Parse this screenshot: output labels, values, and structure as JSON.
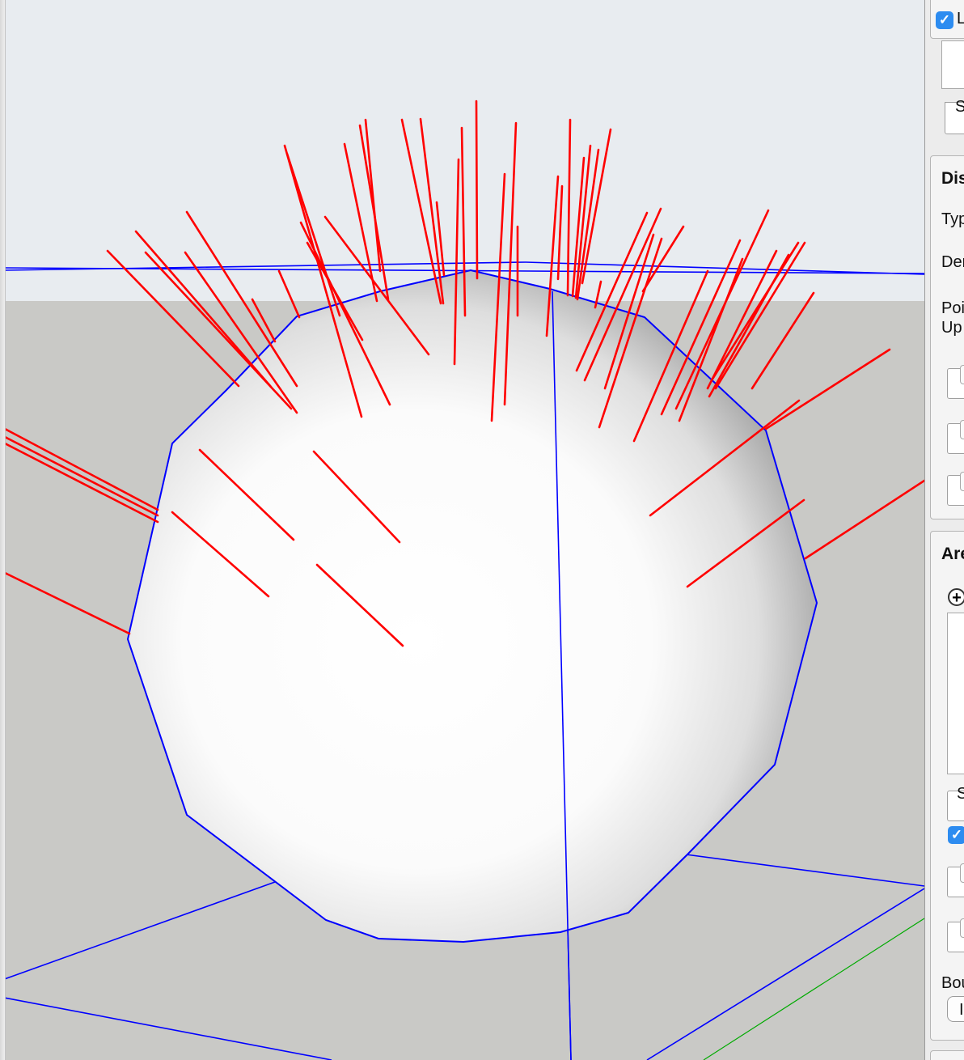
{
  "viewport": {
    "sky_color": "#e8ecf0",
    "ground_color": "#c9c9c6",
    "edge_color": "#0000ff",
    "normal_color": "#ff0000",
    "axis_color": "#00aa00"
  },
  "panel": {
    "top_checkbox_label": "L",
    "top_s_label": "S",
    "display_group": {
      "title": "Dis",
      "type_label": "Typ",
      "density_label": "Der",
      "point_up_label": "Poi\nUp"
    },
    "area_group": {
      "title": "Are",
      "add_icon": "plus-circle-icon",
      "s_label": "S"
    },
    "bottom": {
      "bounds_label": "Bou",
      "button_label": "I"
    }
  }
}
